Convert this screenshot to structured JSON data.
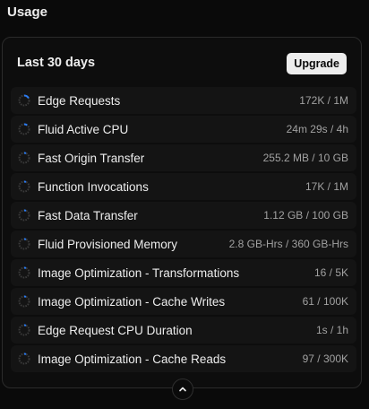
{
  "section": {
    "title": "Usage"
  },
  "card": {
    "period": "Last 30 days",
    "upgrade_label": "Upgrade"
  },
  "colors": {
    "ring_track": "#3a3a3a",
    "ring_fill": "#2b7bf0"
  },
  "items": [
    {
      "label": "Edge Requests",
      "value": "172K / 1M",
      "progress": 0.172
    },
    {
      "label": "Fluid Active CPU",
      "value": "24m 29s / 4h",
      "progress": 0.1
    },
    {
      "label": "Fast Origin Transfer",
      "value": "255.2 MB / 10 GB",
      "progress": 0.026
    },
    {
      "label": "Function Invocations",
      "value": "17K / 1M",
      "progress": 0.017
    },
    {
      "label": "Fast Data Transfer",
      "value": "1.12 GB / 100 GB",
      "progress": 0.011
    },
    {
      "label": "Fluid Provisioned Memory",
      "value": "2.8 GB-Hrs / 360 GB-Hrs",
      "progress": 0.008
    },
    {
      "label": "Image Optimization - Transformations",
      "value": "16 / 5K",
      "progress": 0.003
    },
    {
      "label": "Image Optimization - Cache Writes",
      "value": "61 / 100K",
      "progress": 0.0006
    },
    {
      "label": "Edge Request CPU Duration",
      "value": "1s / 1h",
      "progress": 0.0003
    },
    {
      "label": "Image Optimization - Cache Reads",
      "value": "97 / 300K",
      "progress": 0.0003
    }
  ],
  "collapse_icon": "chevron-up-icon"
}
